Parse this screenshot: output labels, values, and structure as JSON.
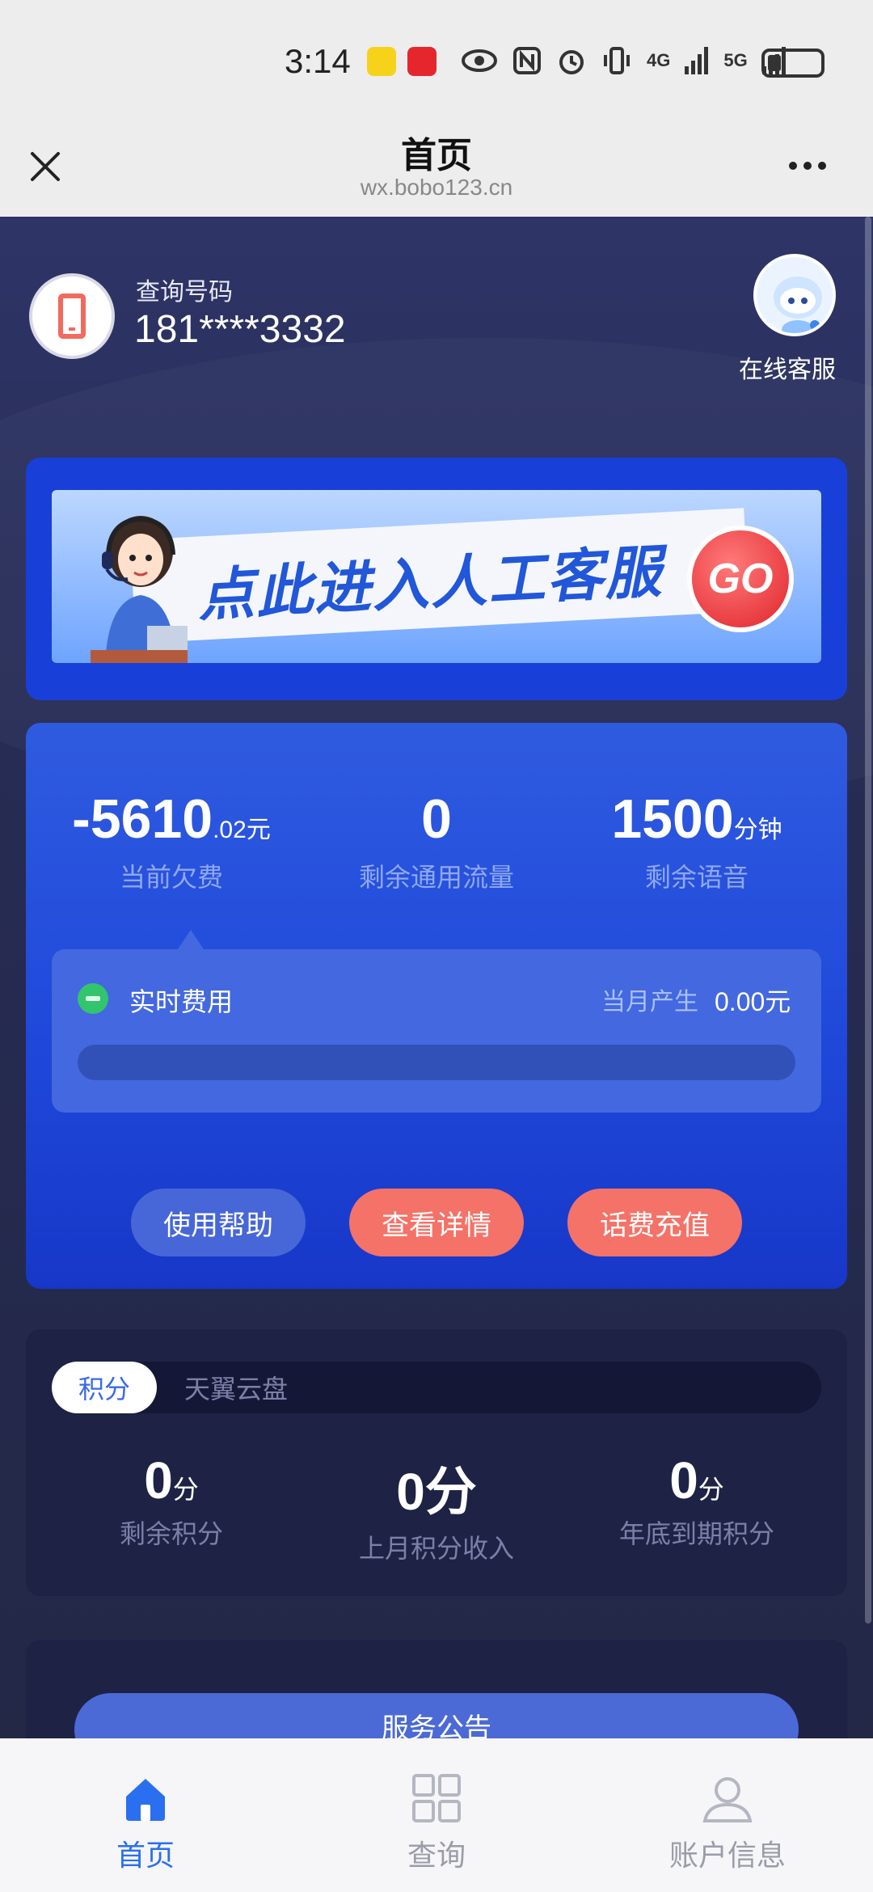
{
  "status_bar": {
    "time": "3:14",
    "icons": [
      "eye-icon",
      "nfc-icon",
      "alarm-icon",
      "vibrate-icon",
      "signal-4g-icon",
      "signal-5g-icon",
      "battery-icon"
    ],
    "net1": "4G",
    "net2": "5G"
  },
  "title_bar": {
    "title": "首页",
    "url": "wx.bobo123.cn"
  },
  "account": {
    "query_label": "查询号码",
    "number": "181****3332",
    "service_label": "在线客服"
  },
  "banner": {
    "text": "点此进入人工客服",
    "go_label": "GO"
  },
  "balance": {
    "due_value": "-5610",
    "due_decimal": ".02",
    "due_unit": "元",
    "due_label": "当前欠费",
    "data_value": "0",
    "data_label": "剩余通用流量",
    "voice_value": "1500",
    "voice_unit": "分钟",
    "voice_label": "剩余语音",
    "realtime_title": "实时费用",
    "month_label": "当月产生",
    "month_value": "0.00元",
    "btn_help": "使用帮助",
    "btn_detail": "查看详情",
    "btn_recharge": "话费充值"
  },
  "points": {
    "tab_active": "积分",
    "tab_inactive": "天翼云盘",
    "remain_value": "0",
    "remain_unit": "分",
    "remain_label": "剩余积分",
    "last_value": "0分",
    "last_label": "上月积分收入",
    "expire_value": "0",
    "expire_unit": "分",
    "expire_label": "年底到期积分"
  },
  "notice": {
    "label": "服务公告"
  },
  "bottom_nav": {
    "home": "首页",
    "query": "查询",
    "account": "账户信息"
  },
  "colors": {
    "accent": "#1e47d9",
    "coral": "#f47268",
    "nav_active": "#2a6ff0"
  }
}
